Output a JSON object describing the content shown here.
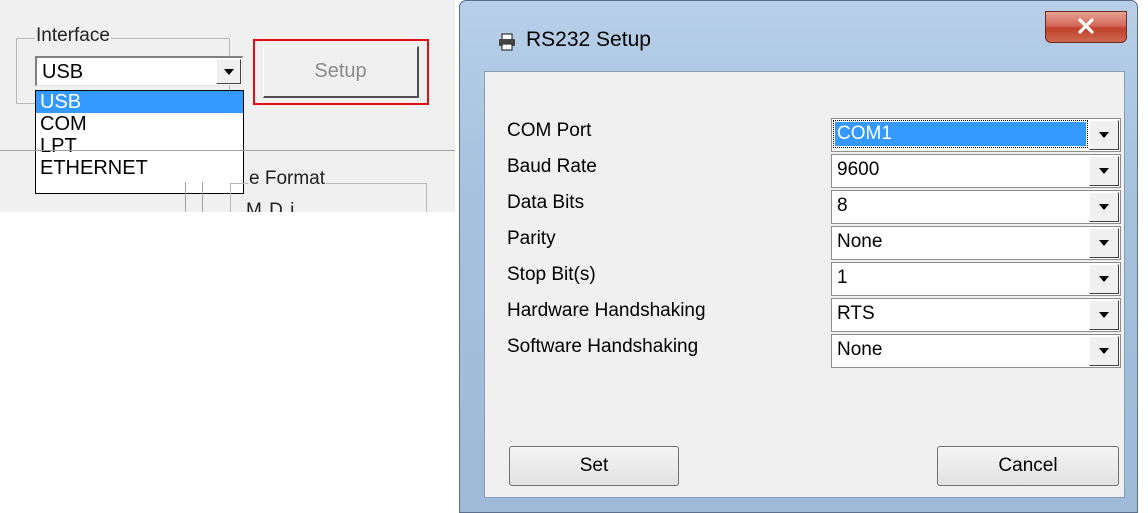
{
  "left": {
    "interface_label": "Interface",
    "interface_value": "USB",
    "interface_options": [
      "USB",
      "COM",
      "LPT",
      "ETHERNET"
    ],
    "selected_option": "USB",
    "setup_label": "Setup",
    "format_label": "e Format",
    "format_sub": "M      D     i"
  },
  "dialog": {
    "title": "RS232 Setup",
    "fields": [
      {
        "label": "COM Port",
        "value": "COM1"
      },
      {
        "label": "Baud Rate",
        "value": "9600"
      },
      {
        "label": "Data Bits",
        "value": "8"
      },
      {
        "label": "Parity",
        "value": "None"
      },
      {
        "label": "Stop Bit(s)",
        "value": "1"
      },
      {
        "label": "Hardware Handshaking",
        "value": "RTS"
      },
      {
        "label": "Software Handshaking",
        "value": "None"
      }
    ],
    "set_label": "Set",
    "cancel_label": "Cancel"
  },
  "colors": {
    "selection": "#3399ff",
    "highlight_box": "#e01010",
    "close_button": "#c7402a"
  },
  "icons": {
    "title_icon": "printer-icon",
    "close_icon": "close-icon",
    "dropdown_icon": "chevron-down-icon"
  }
}
